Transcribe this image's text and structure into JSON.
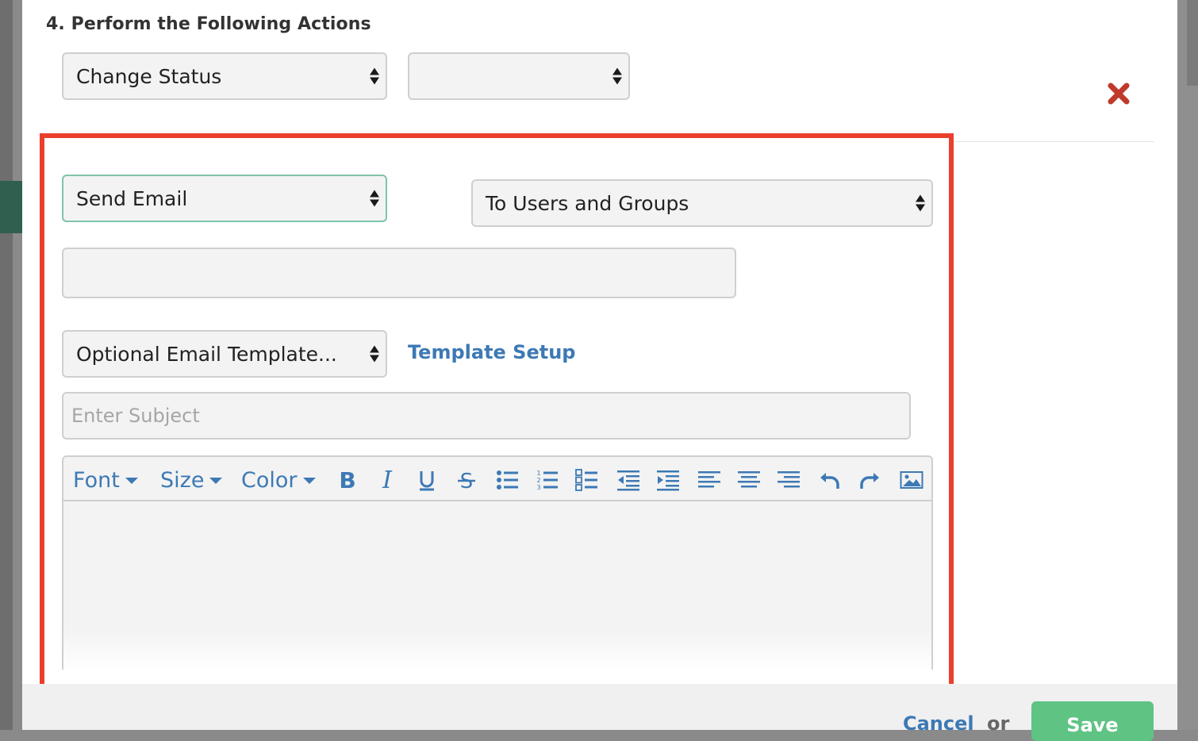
{
  "section": {
    "title": "4. Perform the Following Actions"
  },
  "action1": {
    "type_value": "Change Status",
    "target_value": ""
  },
  "action2": {
    "type_value": "Send Email",
    "recipient_mode": "To Users and Groups",
    "recipients_value": "",
    "template_value": "Optional Email Template...",
    "template_link": "Template Setup",
    "subject_placeholder": "Enter Subject",
    "subject_value": "",
    "body_value": ""
  },
  "toolbar": {
    "font_label": "Font",
    "size_label": "Size",
    "color_label": "Color",
    "buttons": [
      "bold-icon",
      "italic-icon",
      "underline-icon",
      "strikethrough-icon",
      "bullet-list-icon",
      "numbered-list-icon",
      "checklist-icon",
      "outdent-icon",
      "indent-icon",
      "align-left-icon",
      "align-center-icon",
      "align-right-icon",
      "undo-icon",
      "redo-icon",
      "image-icon"
    ]
  },
  "footer": {
    "cancel_label": "Cancel",
    "or_label": "or",
    "save_label": "Save"
  },
  "colors": {
    "link": "#3d79b4",
    "highlight": "#ea3f2b",
    "delete": "#c0392b",
    "save": "#5fc384",
    "focus": "#7fc4a8"
  }
}
